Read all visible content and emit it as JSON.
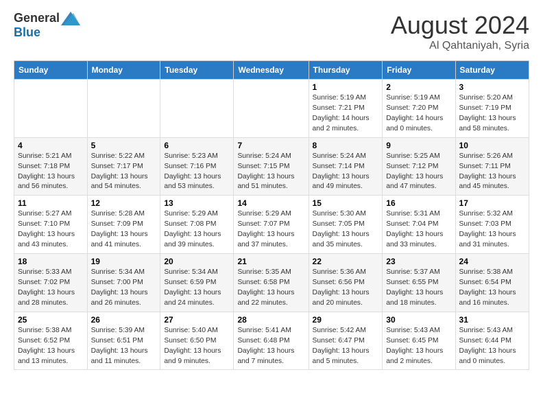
{
  "header": {
    "logo_general": "General",
    "logo_blue": "Blue",
    "month_title": "August 2024",
    "location": "Al Qahtaniyah, Syria"
  },
  "days_of_week": [
    "Sunday",
    "Monday",
    "Tuesday",
    "Wednesday",
    "Thursday",
    "Friday",
    "Saturday"
  ],
  "weeks": [
    [
      {
        "num": "",
        "detail": ""
      },
      {
        "num": "",
        "detail": ""
      },
      {
        "num": "",
        "detail": ""
      },
      {
        "num": "",
        "detail": ""
      },
      {
        "num": "1",
        "detail": "Sunrise: 5:19 AM\nSunset: 7:21 PM\nDaylight: 14 hours\nand 2 minutes."
      },
      {
        "num": "2",
        "detail": "Sunrise: 5:19 AM\nSunset: 7:20 PM\nDaylight: 14 hours\nand 0 minutes."
      },
      {
        "num": "3",
        "detail": "Sunrise: 5:20 AM\nSunset: 7:19 PM\nDaylight: 13 hours\nand 58 minutes."
      }
    ],
    [
      {
        "num": "4",
        "detail": "Sunrise: 5:21 AM\nSunset: 7:18 PM\nDaylight: 13 hours\nand 56 minutes."
      },
      {
        "num": "5",
        "detail": "Sunrise: 5:22 AM\nSunset: 7:17 PM\nDaylight: 13 hours\nand 54 minutes."
      },
      {
        "num": "6",
        "detail": "Sunrise: 5:23 AM\nSunset: 7:16 PM\nDaylight: 13 hours\nand 53 minutes."
      },
      {
        "num": "7",
        "detail": "Sunrise: 5:24 AM\nSunset: 7:15 PM\nDaylight: 13 hours\nand 51 minutes."
      },
      {
        "num": "8",
        "detail": "Sunrise: 5:24 AM\nSunset: 7:14 PM\nDaylight: 13 hours\nand 49 minutes."
      },
      {
        "num": "9",
        "detail": "Sunrise: 5:25 AM\nSunset: 7:12 PM\nDaylight: 13 hours\nand 47 minutes."
      },
      {
        "num": "10",
        "detail": "Sunrise: 5:26 AM\nSunset: 7:11 PM\nDaylight: 13 hours\nand 45 minutes."
      }
    ],
    [
      {
        "num": "11",
        "detail": "Sunrise: 5:27 AM\nSunset: 7:10 PM\nDaylight: 13 hours\nand 43 minutes."
      },
      {
        "num": "12",
        "detail": "Sunrise: 5:28 AM\nSunset: 7:09 PM\nDaylight: 13 hours\nand 41 minutes."
      },
      {
        "num": "13",
        "detail": "Sunrise: 5:29 AM\nSunset: 7:08 PM\nDaylight: 13 hours\nand 39 minutes."
      },
      {
        "num": "14",
        "detail": "Sunrise: 5:29 AM\nSunset: 7:07 PM\nDaylight: 13 hours\nand 37 minutes."
      },
      {
        "num": "15",
        "detail": "Sunrise: 5:30 AM\nSunset: 7:05 PM\nDaylight: 13 hours\nand 35 minutes."
      },
      {
        "num": "16",
        "detail": "Sunrise: 5:31 AM\nSunset: 7:04 PM\nDaylight: 13 hours\nand 33 minutes."
      },
      {
        "num": "17",
        "detail": "Sunrise: 5:32 AM\nSunset: 7:03 PM\nDaylight: 13 hours\nand 31 minutes."
      }
    ],
    [
      {
        "num": "18",
        "detail": "Sunrise: 5:33 AM\nSunset: 7:02 PM\nDaylight: 13 hours\nand 28 minutes."
      },
      {
        "num": "19",
        "detail": "Sunrise: 5:34 AM\nSunset: 7:00 PM\nDaylight: 13 hours\nand 26 minutes."
      },
      {
        "num": "20",
        "detail": "Sunrise: 5:34 AM\nSunset: 6:59 PM\nDaylight: 13 hours\nand 24 minutes."
      },
      {
        "num": "21",
        "detail": "Sunrise: 5:35 AM\nSunset: 6:58 PM\nDaylight: 13 hours\nand 22 minutes."
      },
      {
        "num": "22",
        "detail": "Sunrise: 5:36 AM\nSunset: 6:56 PM\nDaylight: 13 hours\nand 20 minutes."
      },
      {
        "num": "23",
        "detail": "Sunrise: 5:37 AM\nSunset: 6:55 PM\nDaylight: 13 hours\nand 18 minutes."
      },
      {
        "num": "24",
        "detail": "Sunrise: 5:38 AM\nSunset: 6:54 PM\nDaylight: 13 hours\nand 16 minutes."
      }
    ],
    [
      {
        "num": "25",
        "detail": "Sunrise: 5:38 AM\nSunset: 6:52 PM\nDaylight: 13 hours\nand 13 minutes."
      },
      {
        "num": "26",
        "detail": "Sunrise: 5:39 AM\nSunset: 6:51 PM\nDaylight: 13 hours\nand 11 minutes."
      },
      {
        "num": "27",
        "detail": "Sunrise: 5:40 AM\nSunset: 6:50 PM\nDaylight: 13 hours\nand 9 minutes."
      },
      {
        "num": "28",
        "detail": "Sunrise: 5:41 AM\nSunset: 6:48 PM\nDaylight: 13 hours\nand 7 minutes."
      },
      {
        "num": "29",
        "detail": "Sunrise: 5:42 AM\nSunset: 6:47 PM\nDaylight: 13 hours\nand 5 minutes."
      },
      {
        "num": "30",
        "detail": "Sunrise: 5:43 AM\nSunset: 6:45 PM\nDaylight: 13 hours\nand 2 minutes."
      },
      {
        "num": "31",
        "detail": "Sunrise: 5:43 AM\nSunset: 6:44 PM\nDaylight: 13 hours\nand 0 minutes."
      }
    ]
  ]
}
